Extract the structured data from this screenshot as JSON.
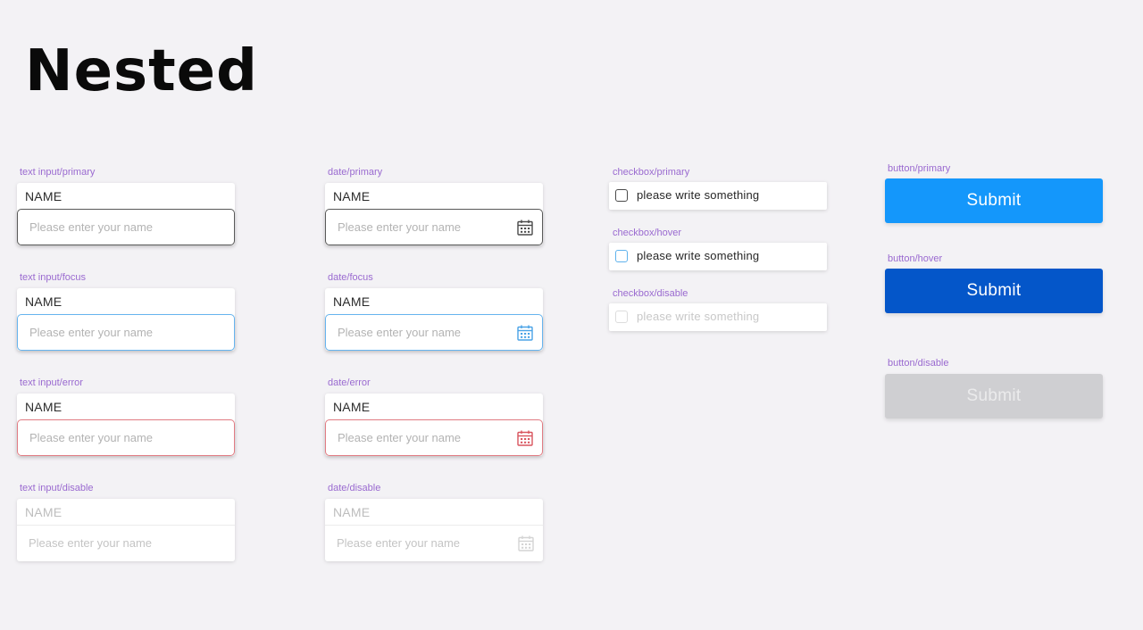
{
  "title": "Nested",
  "text_inputs": [
    {
      "variant": "text input/primary",
      "name_label": "NAME",
      "placeholder": "Please enter your name"
    },
    {
      "variant": "text input/focus",
      "name_label": "NAME",
      "placeholder": "Please enter your name"
    },
    {
      "variant": "text input/error",
      "name_label": "NAME",
      "placeholder": "Please enter your name"
    },
    {
      "variant": "text input/disable",
      "name_label": "NAME",
      "placeholder": "Please enter your name"
    }
  ],
  "date_inputs": [
    {
      "variant": "date/primary",
      "name_label": "NAME",
      "placeholder": "Please enter your name"
    },
    {
      "variant": "date/focus",
      "name_label": "NAME",
      "placeholder": "Please enter your name"
    },
    {
      "variant": "date/error",
      "name_label": "NAME",
      "placeholder": "Please enter your name"
    },
    {
      "variant": "date/disable",
      "name_label": "NAME",
      "placeholder": "Please enter your name"
    }
  ],
  "checkboxes": [
    {
      "variant": "checkbox/primary",
      "label": "please write something"
    },
    {
      "variant": "checkbox/hover",
      "label": "please write something"
    },
    {
      "variant": "checkbox/disable",
      "label": "please write something"
    }
  ],
  "buttons": [
    {
      "variant": "button/primary",
      "label": "Submit"
    },
    {
      "variant": "button/hover",
      "label": "Submit"
    },
    {
      "variant": "button/disable",
      "label": "Submit"
    }
  ],
  "colors": {
    "background": "#f3f2f5",
    "variant_label": "#9a6ad0",
    "focus": "#66b4ef",
    "error": "#e27c84",
    "button_primary": "#1497fb",
    "button_hover": "#0456c9",
    "button_disable": "#cfcfd2"
  },
  "icons": {
    "date_field": "calendar-icon",
    "checkbox": "checkbox-square"
  }
}
